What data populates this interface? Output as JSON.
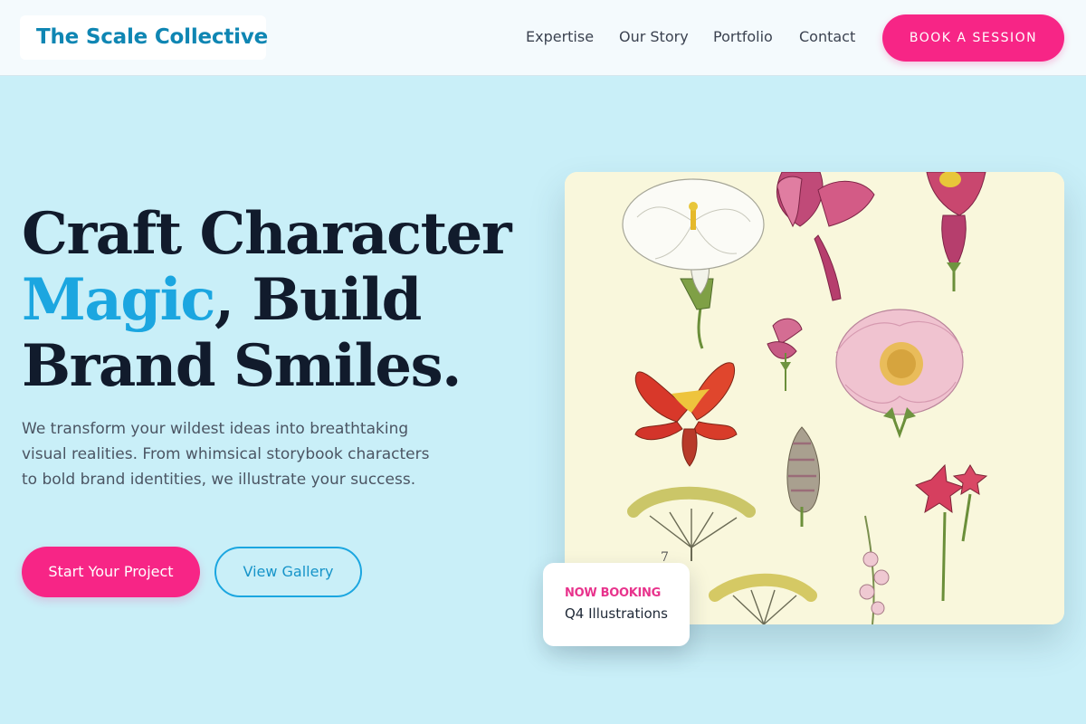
{
  "header": {
    "logo": "The Scale Collective",
    "nav": [
      "Expertise",
      "Our Story",
      "Portfolio",
      "Contact"
    ],
    "cta": "BOOK A SESSION"
  },
  "hero": {
    "headline_line1": "Craft Character",
    "headline_accent": "Magic",
    "headline_line2_rest": ", Build",
    "headline_line3": "Brand Smiles.",
    "description": "We transform your wildest ideas into breathtaking visual realities. From whimsical storybook characters to bold brand identities, we illustrate your success.",
    "primary_button": "Start Your Project",
    "secondary_button": "View Gallery",
    "image_label": "botanical-flower-illustration",
    "image_number": "7"
  },
  "booking_card": {
    "tag": "NOW BOOKING",
    "text": "Q4 Illustrations"
  },
  "colors": {
    "background": "#c9eff8",
    "accent_pink": "#f72586",
    "accent_blue": "#1ba6e0",
    "heading": "#111b2c",
    "logo": "#0f86b3"
  }
}
